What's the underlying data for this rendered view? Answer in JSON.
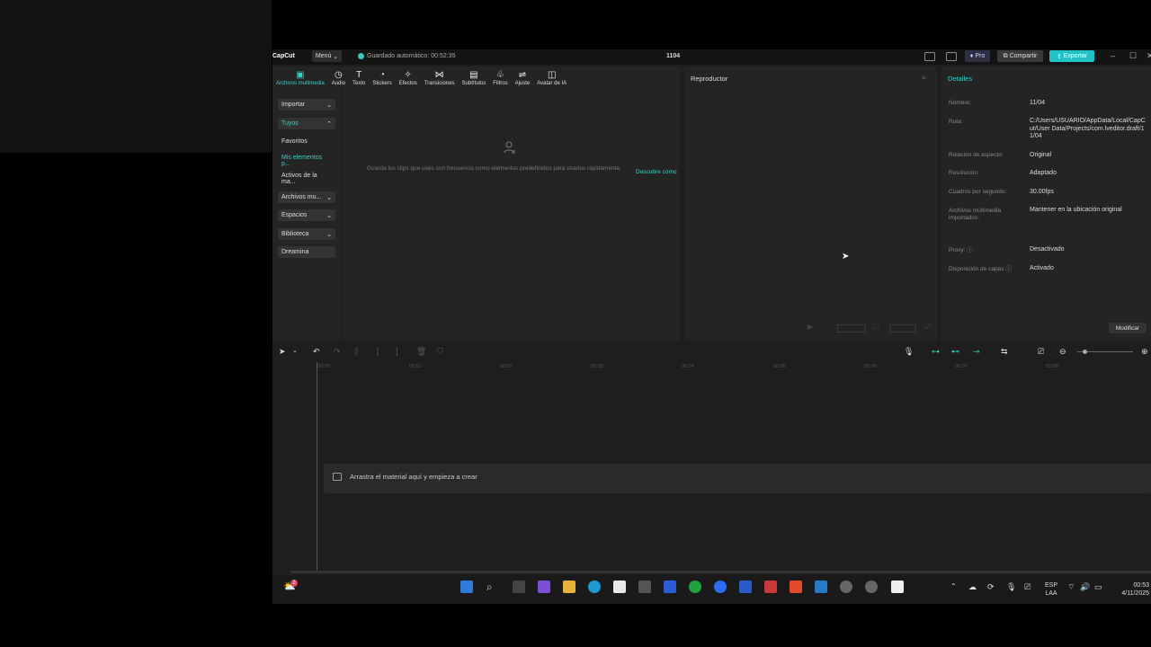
{
  "app": {
    "logo": "CapCut",
    "menu_label": "Menú",
    "autosave": "Guardado automático: 00:52:35",
    "project_title": "1104",
    "pro_label": "Pro",
    "share_label": "Compartir",
    "export_label": "Exportar",
    "accent": "#21c3c6"
  },
  "toolbar": {
    "tools": [
      {
        "label": "Archivos multimedia",
        "icon": "media-icon"
      },
      {
        "label": "Audio",
        "icon": "audio-icon"
      },
      {
        "label": "Texto",
        "icon": "text-icon"
      },
      {
        "label": "Stickers",
        "icon": "sticker-icon"
      },
      {
        "label": "Efectos",
        "icon": "effects-icon"
      },
      {
        "label": "Transiciones",
        "icon": "transition-icon"
      },
      {
        "label": "Subtítulos",
        "icon": "subtitles-icon"
      },
      {
        "label": "Filtros",
        "icon": "filters-icon"
      },
      {
        "label": "Ajuste",
        "icon": "adjust-icon"
      },
      {
        "label": "Avatar de IA",
        "icon": "ai-avatar-icon"
      }
    ]
  },
  "sidebar": {
    "items": [
      {
        "label": "Importar",
        "chevron": "⌄"
      },
      {
        "label": "Tuyos",
        "chevron": "⌃"
      },
      {
        "label": "Favoritos",
        "chevron": ""
      },
      {
        "label": "Mis elementos p...",
        "chevron": ""
      },
      {
        "label": "Activos de la ma...",
        "chevron": ""
      },
      {
        "label": "Archivos mu...",
        "chevron": "⌄"
      },
      {
        "label": "Espacios",
        "chevron": "⌄"
      },
      {
        "label": "Biblioteca",
        "chevron": "⌄"
      },
      {
        "label": "Dreamina",
        "chevron": ""
      }
    ]
  },
  "media": {
    "empty_text": "Guarda los clips que uses con frecuencia como elementos predefinidos para usarlos rápidamente.",
    "discover_link": "Descubre cómo"
  },
  "player": {
    "title": "Reproductor"
  },
  "details": {
    "title": "Detalles",
    "rows": [
      {
        "label": "Nombre:",
        "value": "11/04"
      },
      {
        "label": "Ruta:",
        "value": "C:/Users/USUARIO/AppData/Local/CapCut/User Data/Projects/com.lveditor.draft/11/04"
      },
      {
        "label": "Relación de aspecto:",
        "value": "Original"
      },
      {
        "label": "Resolución:",
        "value": "Adaptado"
      },
      {
        "label": "Cuadros por segundo:",
        "value": "30.00fps"
      },
      {
        "label": "Archivos multimedia importados:",
        "value": "Mantener en la ubicación original"
      },
      {
        "label": "Proxy: ⓘ",
        "value": "Desactivado"
      },
      {
        "label": "Disposición de capas ⓘ",
        "value": "Activado"
      }
    ],
    "modify_label": "Modificar"
  },
  "timeline": {
    "ticks": [
      "00:00",
      "00:01",
      "00:02",
      "00:03",
      "00:04",
      "00:05",
      "00:06",
      "00:07",
      "00:08"
    ],
    "drop_text": "Arrastra el material aquí y empieza a crear"
  },
  "taskbar": {
    "notification_count": "2",
    "lang_top": "ESP",
    "lang_bottom": "LAA",
    "time": "00:53",
    "date": "4/11/2025"
  }
}
